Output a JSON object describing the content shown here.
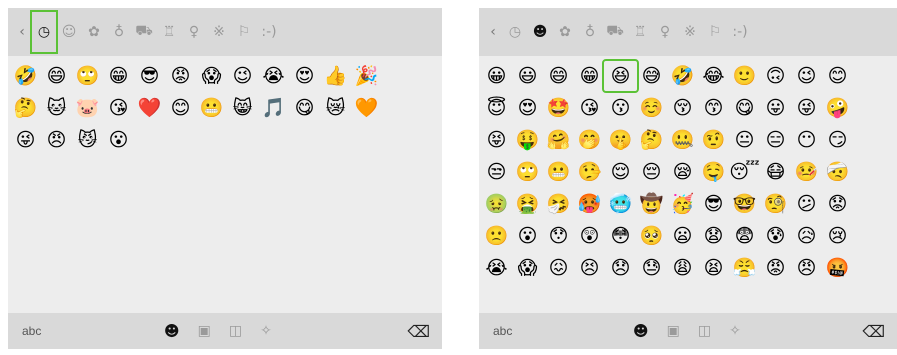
{
  "colors": {
    "highlight": "#5bc236",
    "bar_bg": "#d9d9d9",
    "panel_bg": "#ededed"
  },
  "left": {
    "categories": [
      {
        "name": "back-icon",
        "glyph": "‹"
      },
      {
        "name": "recent-clock-icon",
        "glyph": "◷"
      },
      {
        "name": "smiley-icon",
        "glyph": "☺"
      },
      {
        "name": "animal-icon",
        "glyph": "✿"
      },
      {
        "name": "food-icon",
        "glyph": "♁"
      },
      {
        "name": "car-icon",
        "glyph": "⛟"
      },
      {
        "name": "trophy-icon",
        "glyph": "♖"
      },
      {
        "name": "lightbulb-icon",
        "glyph": "♀"
      },
      {
        "name": "symbols-icon",
        "glyph": "※"
      },
      {
        "name": "flag-icon",
        "glyph": "⚐"
      },
      {
        "name": "emoticon-icon",
        "glyph": ":-)"
      }
    ],
    "active_category": "recent-clock-icon",
    "rows": [
      [
        "🤣",
        "😄",
        "🙄",
        "😁",
        "😎",
        "😡",
        "😱",
        "😉",
        "😭",
        "😍",
        "👍",
        "🎉"
      ],
      [
        "🤔",
        "🐱",
        "🐷",
        "😘",
        "❤️",
        "😊",
        "😬",
        "😸",
        "🎵",
        "😋",
        "😿",
        "🧡"
      ],
      [
        "😜",
        "😠",
        "😼",
        "😮"
      ]
    ],
    "bottom": {
      "abc": "abc",
      "icons": [
        {
          "name": "emoji-tab-icon",
          "glyph": "☻",
          "active": true
        },
        {
          "name": "gif-tab-icon",
          "glyph": "▣",
          "active": false
        },
        {
          "name": "sticker-tab-icon",
          "glyph": "◫",
          "active": false
        },
        {
          "name": "kaomoji-tab-icon",
          "glyph": "✧",
          "active": false
        }
      ],
      "backspace": "⌫"
    }
  },
  "right": {
    "categories": [
      {
        "name": "back-icon",
        "glyph": "‹"
      },
      {
        "name": "recent-clock-icon",
        "glyph": "◷"
      },
      {
        "name": "smiley-icon",
        "glyph": "☻"
      },
      {
        "name": "animal-icon",
        "glyph": "✿"
      },
      {
        "name": "food-icon",
        "glyph": "♁"
      },
      {
        "name": "car-icon",
        "glyph": "⛟"
      },
      {
        "name": "trophy-icon",
        "glyph": "♖"
      },
      {
        "name": "lightbulb-icon",
        "glyph": "♀"
      },
      {
        "name": "symbols-icon",
        "glyph": "※"
      },
      {
        "name": "flag-icon",
        "glyph": "⚐"
      },
      {
        "name": "emoticon-icon",
        "glyph": ":-)"
      }
    ],
    "active_category": "smiley-icon",
    "rows": [
      [
        "😀",
        "😃",
        "😄",
        "😁",
        "😆",
        "😅",
        "🤣",
        "😂",
        "🙂",
        "🙃",
        "😉",
        "😊"
      ],
      [
        "😇",
        "😍",
        "🤩",
        "😘",
        "😗",
        "☺️",
        "😚",
        "😙",
        "😋",
        "😛",
        "😜",
        "🤪"
      ],
      [
        "😝",
        "🤑",
        "🤗",
        "🤭",
        "🤫",
        "🤔",
        "🤐",
        "🤨",
        "😐",
        "😑",
        "😶",
        "😏"
      ],
      [
        "😒",
        "🙄",
        "😬",
        "🤥",
        "😌",
        "😔",
        "😪",
        "🤤",
        "😴",
        "😷",
        "🤒",
        "🤕"
      ],
      [
        "🤢",
        "🤮",
        "🤧",
        "🥵",
        "🥶",
        "🤠",
        "🥳",
        "😎",
        "🤓",
        "🧐",
        "😕",
        "😟"
      ],
      [
        "🙁",
        "😮",
        "😯",
        "😲",
        "😳",
        "🥺",
        "😦",
        "😧",
        "😨",
        "😰",
        "😥",
        "😢"
      ],
      [
        "😭",
        "😱",
        "😖",
        "😣",
        "😞",
        "😓",
        "😩",
        "😫",
        "😤",
        "😡",
        "😠",
        "🤬"
      ]
    ],
    "highlight_row": 0,
    "highlight_col": 4,
    "bottom": {
      "abc": "abc",
      "icons": [
        {
          "name": "emoji-tab-icon",
          "glyph": "☻",
          "active": true
        },
        {
          "name": "gif-tab-icon",
          "glyph": "▣",
          "active": false
        },
        {
          "name": "sticker-tab-icon",
          "glyph": "◫",
          "active": false
        },
        {
          "name": "kaomoji-tab-icon",
          "glyph": "✧",
          "active": false
        }
      ],
      "backspace": "⌫"
    }
  }
}
